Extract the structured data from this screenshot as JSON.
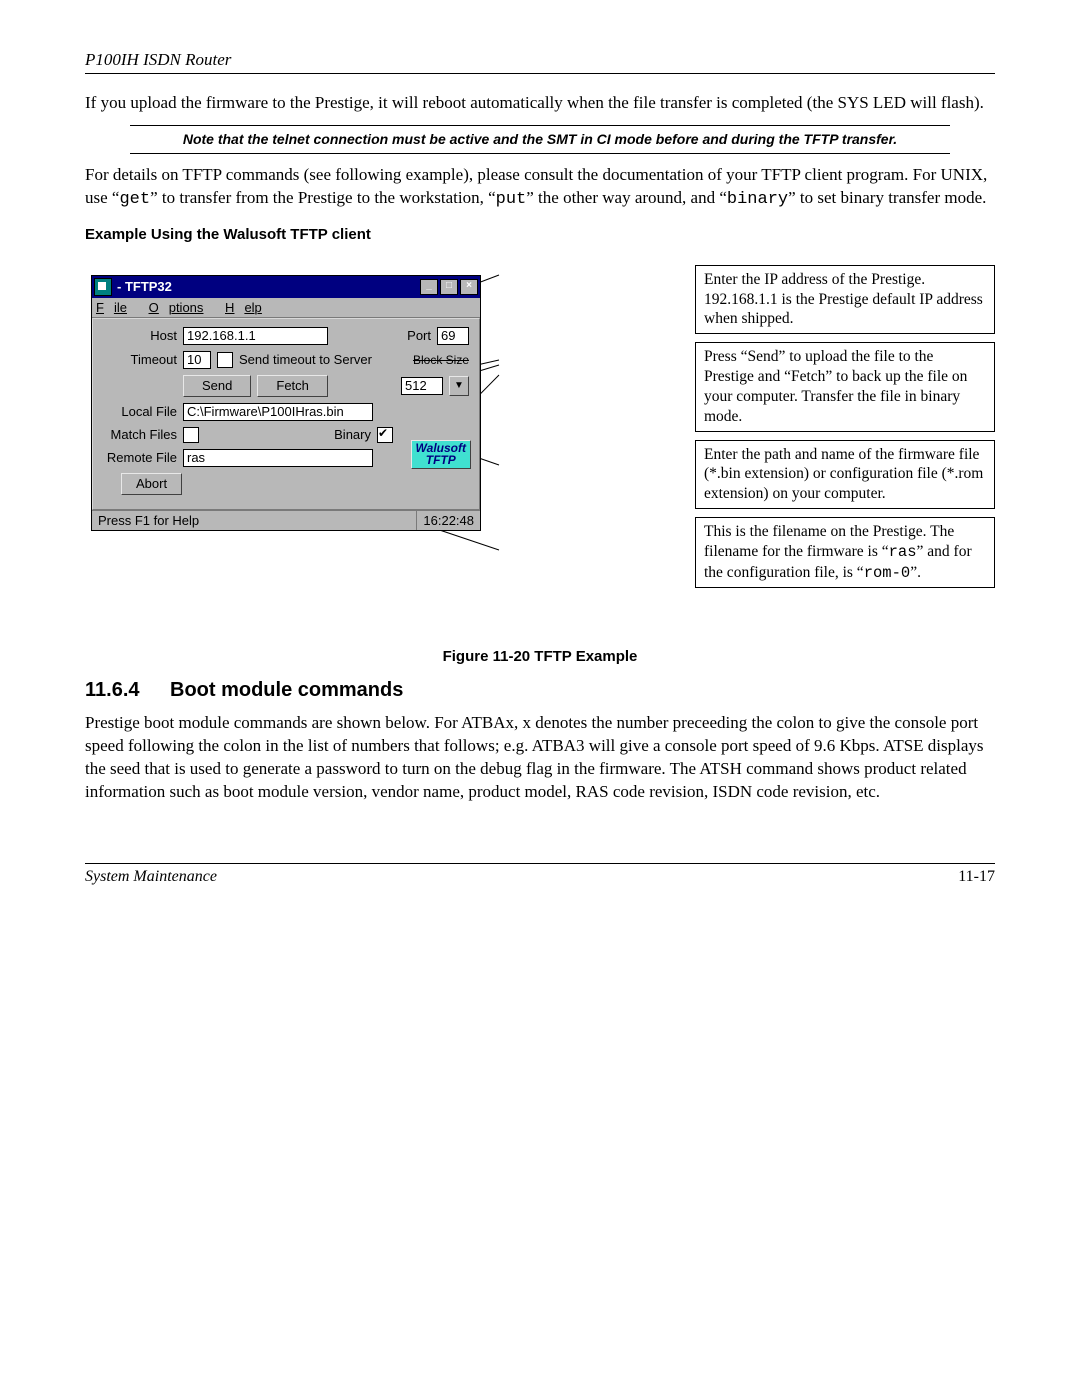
{
  "header": {
    "title": "P100IH ISDN Router"
  },
  "para1": "If you upload the firmware to the Prestige, it will reboot automatically when the file transfer is completed (the SYS LED will flash).",
  "notice": "Note that the telnet connection must be active and the SMT in CI mode before and during the TFTP transfer.",
  "para2_a": "For details on TFTP commands (see following example), please consult the documentation of your TFTP client program. For UNIX, use “",
  "para2_code1": "get",
  "para2_b": "” to transfer from the Prestige to the workstation, “",
  "para2_code2": "put",
  "para2_c": "” the other way around, and “",
  "para2_code3": "binary",
  "para2_d": "” to set binary transfer mode.",
  "example_heading": "Example Using the Walusoft TFTP client",
  "window": {
    "title": " - TFTP32",
    "menu": {
      "file": "File",
      "options": "Options",
      "help": "Help",
      "fu": "F",
      "ou": "O",
      "hu": "H",
      "file_rest": "ile",
      "options_rest": "ptions",
      "help_rest": "elp"
    },
    "labels": {
      "host": "Host",
      "port": "Port",
      "timeout": "Timeout",
      "send_timeout": "Send timeout to Server",
      "block_size": "Block Size",
      "local_file": "Local File",
      "match_files": "Match Files",
      "binary": "Binary",
      "remote_file": "Remote File"
    },
    "values": {
      "host": "192.168.1.1",
      "port": "69",
      "timeout": "10",
      "block_size": "512",
      "local_file": "C:\\Firmware\\P100IHras.bin",
      "remote_file": "ras"
    },
    "buttons": {
      "send": "Send",
      "fetch": "Fetch",
      "abort": "Abort"
    },
    "brand_line1": "Walusoft",
    "brand_line2": "TFTP",
    "status_left": "Press F1 for Help",
    "status_right": "16:22:48",
    "win_min": "_",
    "win_max": "□",
    "win_close": "×"
  },
  "callouts": {
    "c1": "Enter the IP address of the Prestige. 192.168.1.1 is the Prestige default IP address when shipped.",
    "c2": "Press “Send” to upload the file to the Prestige and “Fetch” to back up the file on your computer. Transfer the file in binary mode.",
    "c3": "Enter the path and name of the firmware file (*.bin extension) or configuration file (*.rom extension) on your computer.",
    "c4_a": "This is the filename on the Prestige. The filename for the firmware is “",
    "c4_code1": "ras",
    "c4_b": "” and for the configuration file, is “",
    "c4_code2": "rom-0",
    "c4_c": "”."
  },
  "figcap": "Figure 11-20 TFTP Example",
  "section": {
    "num": "11.6.4",
    "title": "Boot module commands"
  },
  "para3": "Prestige boot module commands are shown below. For ATBAx, x denotes the number preceeding the colon to give the console port speed following the colon in the list of numbers that follows; e.g. ATBA3 will give a console port speed of 9.6 Kbps. ATSE displays the seed that is used to generate a password to turn on the debug flag in the firmware. The ATSH command shows product related information such as boot module version, vendor name, product model, RAS code revision, ISDN code revision, etc.",
  "footer": {
    "left": "System Maintenance",
    "right": "11-17"
  }
}
